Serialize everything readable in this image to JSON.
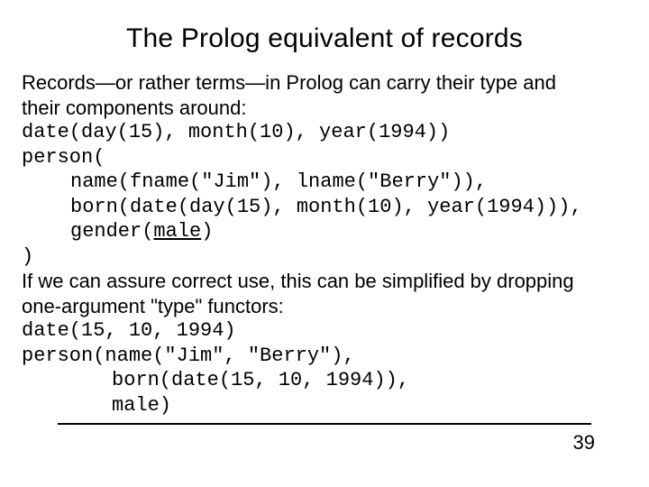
{
  "title": "The Prolog equivalent of records",
  "intro1": "Records—or rather terms—in Prolog can carry their type and",
  "intro2": "their components around:",
  "code1": "date(day(15), month(10), year(1994))",
  "code2": "person(",
  "code3": "name(fname(\"Jim\"), lname(\"Berry\")),",
  "code4": "born(date(day(15), month(10), year(1994))),",
  "code5a": "gender(",
  "code5b": "male",
  "code5c": ")",
  "code6": ")",
  "mid1": "If we can assure correct use, this can be simplified by dropping",
  "mid2": "one-argument \"type\" functors:",
  "code7": "date(15, 10, 1994)",
  "code8": "person(name(\"Jim\", \"Berry\"),",
  "code9": "born(date(15, 10, 1994)),",
  "code10": "male)",
  "pagenum": "39"
}
